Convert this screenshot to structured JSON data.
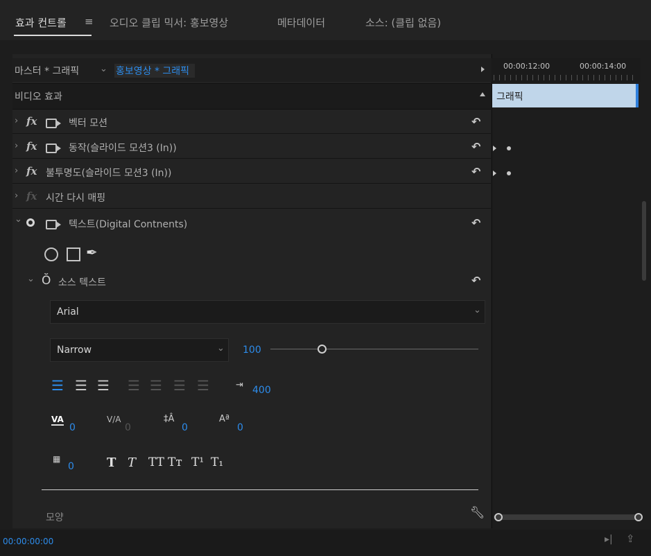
{
  "tabs": [
    "효과 컨트롤",
    "오디오 클립 믹서: 홍보영상",
    "메타데이터",
    "소스: (클립 없음)"
  ],
  "menu_icon": "≡",
  "breadcrumb": {
    "master": "마스터 * 그래픽",
    "sequence": "홍보영상 * 그래픽"
  },
  "section_header": "비디오 효과",
  "effects": [
    {
      "label": "벡터 모션"
    },
    {
      "label": "동작(슬라이드 모션3 (In))"
    },
    {
      "label": "불투명도(슬라이드 모션3 (In))"
    },
    {
      "label": "시간 다시 매핑"
    },
    {
      "label": "텍스트(Digital Contnents)"
    }
  ],
  "source_text_label": "소스 텍스트",
  "font": {
    "family": "Arial",
    "style": "Narrow",
    "size": "100"
  },
  "tab_stop_value": "400",
  "metrics": {
    "kerning": "0",
    "tracking": "0",
    "leading": "0",
    "baseline": "0",
    "tsume": "0"
  },
  "type_styles": [
    "T",
    "T",
    "TT",
    "Tт",
    "T¹",
    "T₁"
  ],
  "appearance_label": "모양",
  "timeline": {
    "time1": "00:00:12:00",
    "time2": "00:00:14:00",
    "clip_label": "그래픽"
  },
  "timecode": "00:00:00:00",
  "colors": {
    "accent": "#2d8ceb",
    "clip": "#c0d6ea"
  }
}
